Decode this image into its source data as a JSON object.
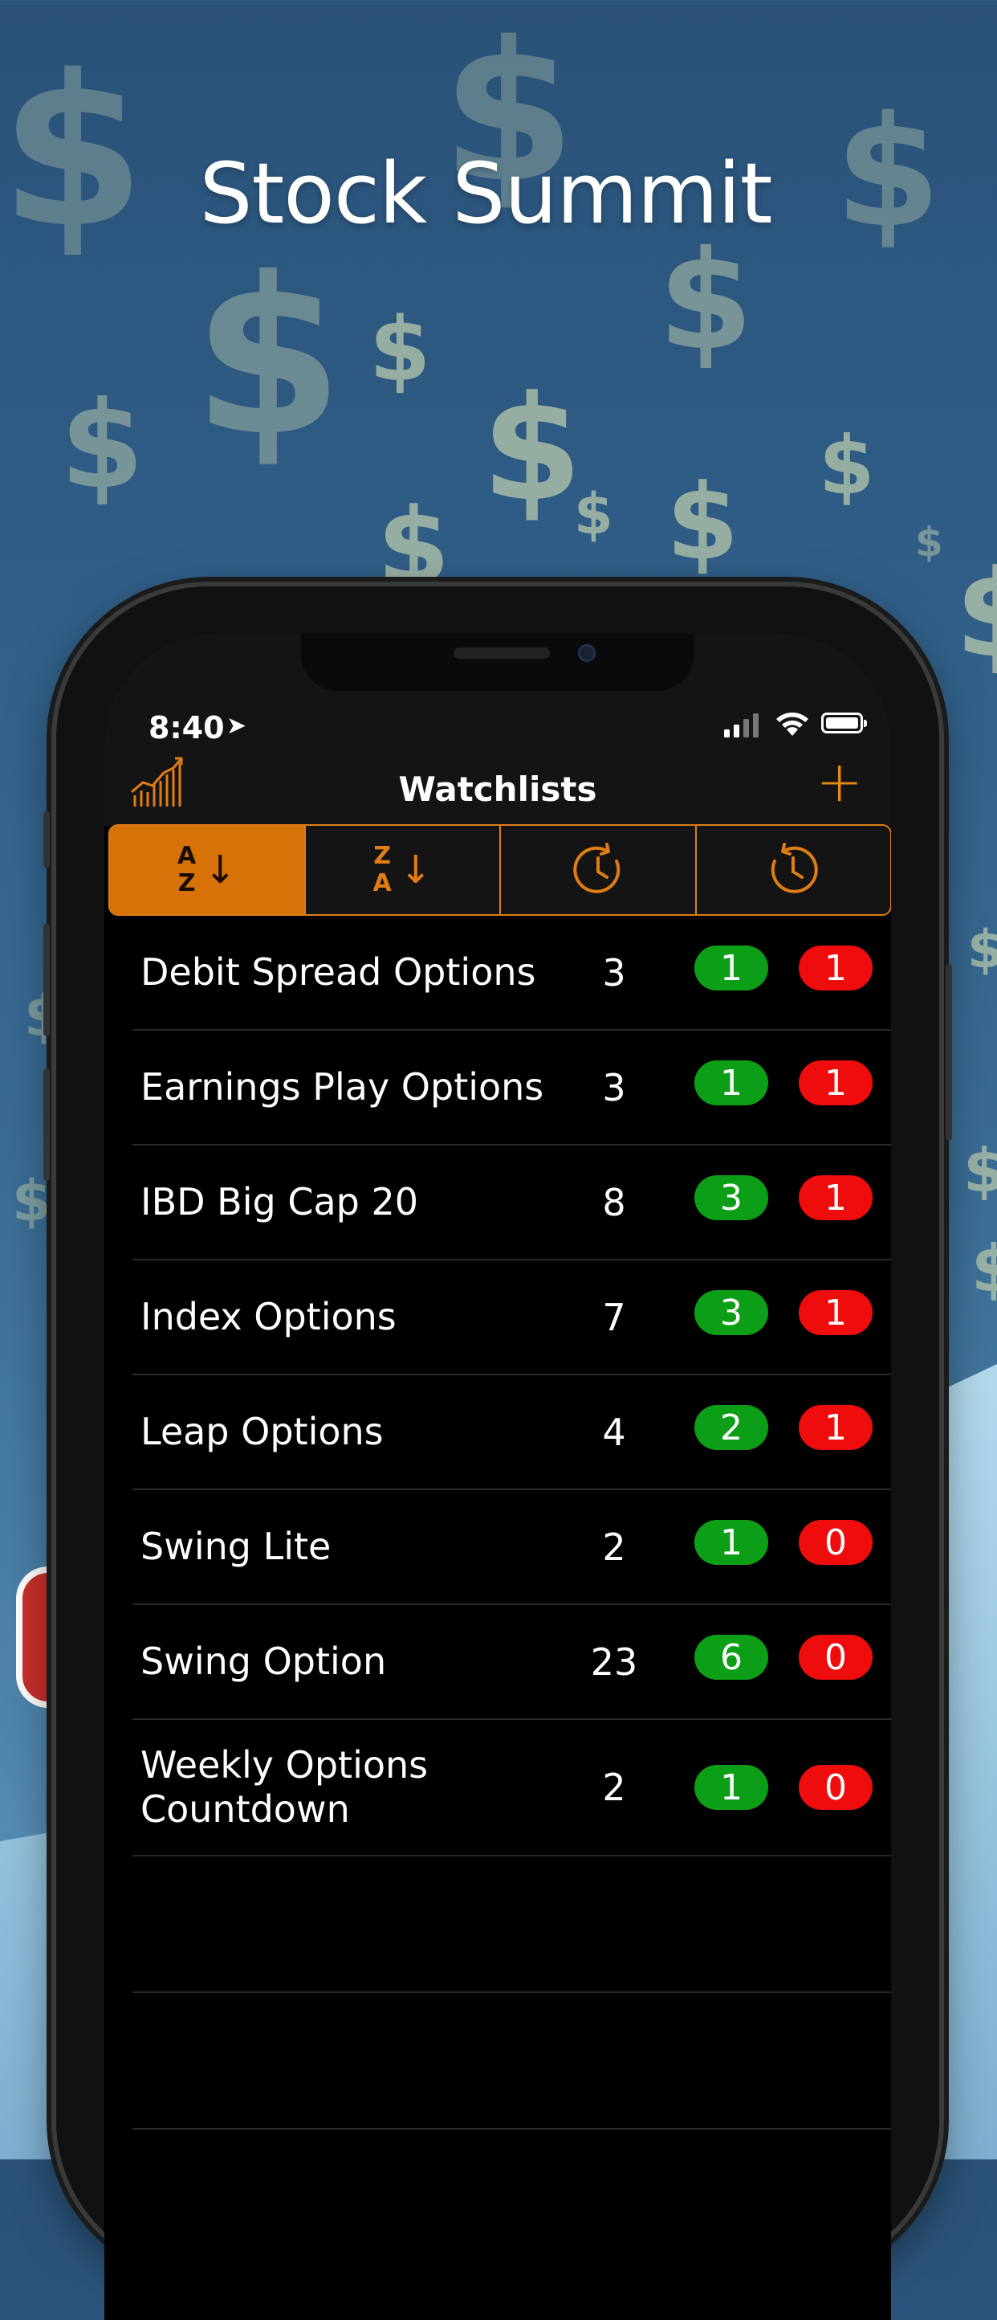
{
  "hero": {
    "title": "Stock Summit"
  },
  "status_bar": {
    "time": "8:40"
  },
  "nav": {
    "title": "Watchlists",
    "add_label": "+"
  },
  "sort_segments": [
    {
      "top": "A",
      "bottom": "Z",
      "icon": "sort-a-z-icon",
      "active": true
    },
    {
      "top": "Z",
      "bottom": "A",
      "icon": "sort-z-a-icon",
      "active": false
    },
    {
      "icon": "clock-forward-icon",
      "active": false
    },
    {
      "icon": "clock-history-icon",
      "active": false
    }
  ],
  "watchlists": [
    {
      "name": "Debit Spread Options",
      "count": "3",
      "up": "1",
      "down": "1"
    },
    {
      "name": "Earnings Play Options",
      "count": "3",
      "up": "1",
      "down": "1"
    },
    {
      "name": "IBD Big Cap 20",
      "count": "8",
      "up": "3",
      "down": "1"
    },
    {
      "name": "Index Options",
      "count": "7",
      "up": "3",
      "down": "1"
    },
    {
      "name": "Leap Options",
      "count": "4",
      "up": "2",
      "down": "1"
    },
    {
      "name": "Swing Lite",
      "count": "2",
      "up": "1",
      "down": "0"
    },
    {
      "name": "Swing Option",
      "count": "23",
      "up": "6",
      "down": "0"
    },
    {
      "name": "Weekly Options Countdown",
      "count": "2",
      "up": "1",
      "down": "0"
    }
  ],
  "colors": {
    "accent": "#e07d14",
    "up": "#0d9e17",
    "down": "#ef0c0c"
  }
}
